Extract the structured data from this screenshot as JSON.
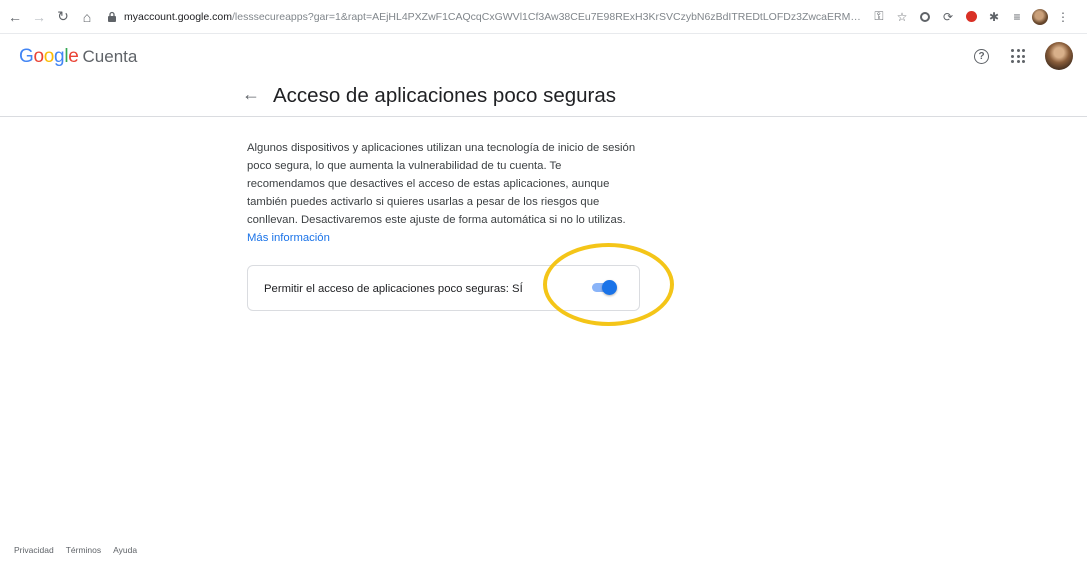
{
  "browser": {
    "url_host": "myaccount.google.com",
    "url_rest": "/lesssecureapps?gar=1&rapt=AEjHL4PXZwF1CAQcqCxGWVl1Cf3Aw38CEu7E98RExH3KrSVCzybN6zBdITREDtLOFDz3ZwcaERMn2Hp9yf4J-4uLSDq..."
  },
  "header": {
    "logo_letters": [
      {
        "char": "G",
        "color": "#4285f4"
      },
      {
        "char": "o",
        "color": "#ea4335"
      },
      {
        "char": "o",
        "color": "#fbbc05"
      },
      {
        "char": "g",
        "color": "#4285f4"
      },
      {
        "char": "l",
        "color": "#34a853"
      },
      {
        "char": "e",
        "color": "#ea4335"
      }
    ],
    "product": "Cuenta",
    "help_glyph": "?"
  },
  "page": {
    "title": "Acceso de aplicaciones poco seguras",
    "description": "Algunos dispositivos y aplicaciones utilizan una tecnología de inicio de sesión poco segura, lo que aumenta la vulnerabilidad de tu cuenta. Te recomendamos que desactives el acceso de estas aplicaciones, aunque también puedes activarlo si quieres usarlas a pesar de los riesgos que conllevan. Desactivaremos este ajuste de forma automática si no lo utilizas.",
    "more_link": "Más información"
  },
  "setting": {
    "label": "Permitir el acceso de aplicaciones poco seguras: SÍ",
    "enabled": true
  },
  "footer": {
    "links": [
      "Privacidad",
      "Términos",
      "Ayuda"
    ]
  },
  "colors": {
    "accent": "#1a73e8",
    "toggle_track": "#8ab4f8",
    "highlight": "#f4c518"
  }
}
